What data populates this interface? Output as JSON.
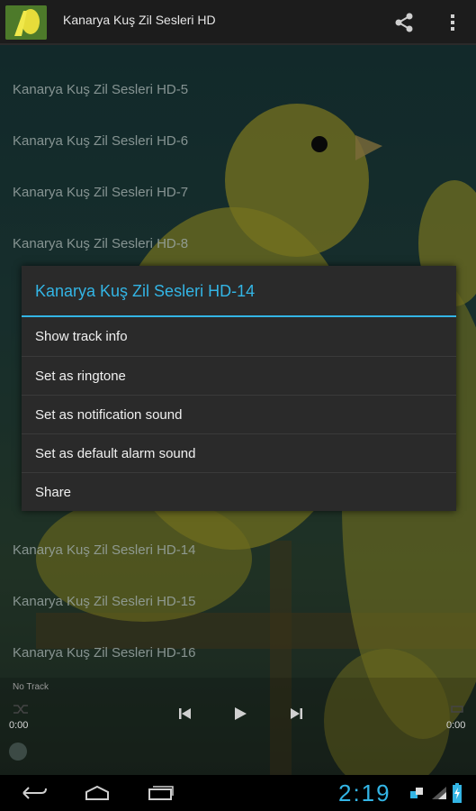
{
  "app_bar": {
    "title": "Kanarya Kuş Zil Sesleri HD"
  },
  "tracks": [
    "Kanarya Kuş Zil Sesleri HD-5",
    "Kanarya Kuş Zil Sesleri HD-6",
    "Kanarya Kuş Zil Sesleri HD-7",
    "Kanarya Kuş Zil Sesleri HD-8",
    "Kanarya Kuş Zil Sesleri HD-14",
    "Kanarya Kuş Zil Sesleri HD-15",
    "Kanarya Kuş Zil Sesleri HD-16"
  ],
  "dialog": {
    "title": "Kanarya Kuş Zil Sesleri HD-14",
    "options": [
      "Show track info",
      "Set as ringtone",
      "Set as notification sound",
      "Set as default alarm sound",
      "Share"
    ]
  },
  "player": {
    "now_playing": "No Track",
    "elapsed": "0:00",
    "duration": "0:00"
  },
  "status_bar": {
    "time": "2:19"
  },
  "icons": {
    "share": "share-icon",
    "overflow": "overflow-menu-icon",
    "back": "back-icon",
    "home": "home-icon",
    "recent": "recent-apps-icon"
  },
  "colors": {
    "accent": "#33b5e5",
    "dialog_bg": "#2a2a2a",
    "action_bar_bg": "#1c1c1c"
  }
}
